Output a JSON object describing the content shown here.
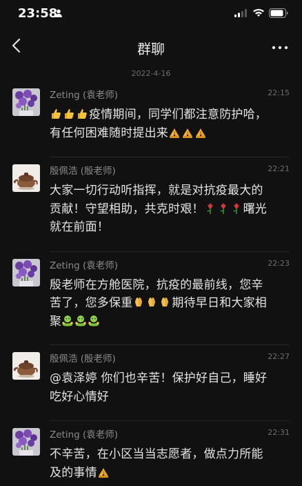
{
  "status_bar": {
    "time": "23:58"
  },
  "header": {
    "title": "群聊"
  },
  "date_separator": "2022-4-16",
  "messages": [
    {
      "sender": "Zeting (袁老师)",
      "time": "22:15",
      "avatar": "purple-flowers",
      "lines": [
        "[thumbs][thumbs][thumbs]疫情期间，同学们都注意防护哈，",
        "有任何困难随时提出来[pray][pray][pray]"
      ]
    },
    {
      "sender": "殷佩浩 (殷老师)",
      "time": "22:21",
      "avatar": "teapot",
      "lines": [
        "大家一切行动听指挥，就是对抗疫最大的",
        "贡献！守望相助，共克时艰！[rose][rose][rose]曙光",
        "就在前面！"
      ]
    },
    {
      "sender": "Zeting (袁老师)",
      "time": "22:23",
      "avatar": "purple-flowers",
      "lines": [
        "殷老师在方舱医院，抗疫的最前线，您辛",
        "苦了，您多保重[pray2][pray2][pray2]期待早日和大家相",
        "聚[hug][hug][hug]"
      ]
    },
    {
      "sender": "殷佩浩 (殷老师)",
      "time": "22:27",
      "avatar": "teapot",
      "lines": [
        "@袁泽婷 你们也辛苦！保护好自己，睡好",
        "吃好心情好"
      ]
    },
    {
      "sender": "Zeting (袁老师)",
      "time": "22:31",
      "avatar": "purple-flowers",
      "lines": [
        "不辛苦，在小区当当志愿者，做点力所能",
        "及的事情[pray]"
      ]
    }
  ],
  "text_segments": {
    "m0l0": "疫情期间，同学们都注意防护哈，",
    "m0l1": "有任何困难随时提出来",
    "m1l0": "大家一切行动听指挥，就是对抗疫最大的",
    "m1l1a": "贡献！守望相助，共克时艰！",
    "m1l1b": "曙光",
    "m1l2": "就在前面！",
    "m2l0": "殷老师在方舱医院，抗疫的最前线，您辛",
    "m2l1a": "苦了，您多保重",
    "m2l1b": "期待早日和大家相",
    "m2l2": "聚",
    "m3l0": "@袁泽婷 你们也辛苦！保护好自己，睡好",
    "m3l1": "吃好心情好",
    "m4l0": "不辛苦，在小区当当志愿者，做点力所能",
    "m4l1": "及的事情"
  },
  "colors": {
    "background": "#111111",
    "text": "#e4e4e4",
    "meta": "#8b8b8b"
  }
}
